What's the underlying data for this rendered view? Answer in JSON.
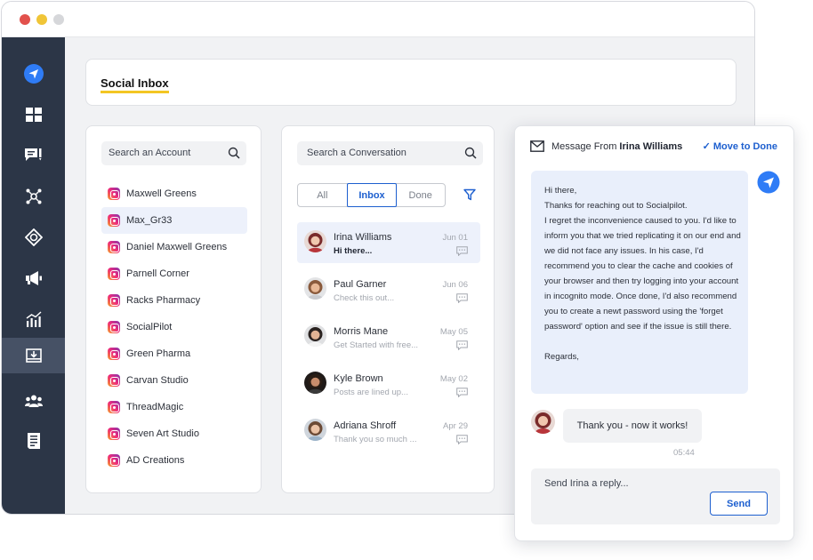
{
  "window": {
    "controls": [
      "close",
      "minimize",
      "maximize"
    ]
  },
  "sidebar": {
    "items": [
      {
        "icon": "paper-plane-icon",
        "active": false
      },
      {
        "icon": "dashboard-icon",
        "active": false
      },
      {
        "icon": "compose-icon",
        "active": false
      },
      {
        "icon": "network-icon",
        "active": false
      },
      {
        "icon": "lifebuoy-icon",
        "active": false
      },
      {
        "icon": "megaphone-icon",
        "active": false
      },
      {
        "icon": "analytics-icon",
        "active": false
      },
      {
        "icon": "inbox-icon",
        "active": true
      },
      {
        "icon": "team-icon",
        "active": false
      },
      {
        "icon": "report-icon",
        "active": false
      }
    ]
  },
  "header": {
    "title": "Social Inbox"
  },
  "accounts": {
    "search_placeholder": "Search an Account",
    "selected_index": 1,
    "items": [
      "Maxwell Greens",
      "Max_Gr33",
      "Daniel Maxwell Greens",
      "Parnell Corner",
      "Racks Pharmacy",
      "SocialPilot",
      "Green Pharma",
      "Carvan Studio",
      "ThreadMagic",
      "Seven Art Studio",
      "AD Creations"
    ]
  },
  "conversations": {
    "search_placeholder": "Search a Conversation",
    "tabs": [
      "All",
      "Inbox",
      "Done"
    ],
    "active_tab": "Inbox",
    "items": [
      {
        "name": "Irina Williams",
        "preview": "Hi there...",
        "date": "Jun 01",
        "selected": true
      },
      {
        "name": "Paul Garner",
        "preview": "Check this out...",
        "date": "Jun 06",
        "selected": false
      },
      {
        "name": "Morris Mane",
        "preview": "Get Started with free...",
        "date": "May 05",
        "selected": false
      },
      {
        "name": "Kyle Brown",
        "preview": "Posts are lined up...",
        "date": "May 02",
        "selected": false
      },
      {
        "name": "Adriana Shroff",
        "preview": "Thank you so much ...",
        "date": "Apr 29",
        "selected": false
      }
    ]
  },
  "message": {
    "from_label": "Message From",
    "from_name": "Irina Williams",
    "move_to_done": "Move to Done",
    "body": [
      "Hi there,",
      "Thanks for reaching out to Socialpilot.",
      "I regret the inconvenience caused to you. I'd like to inform you that we tried replicating it on our end and we did not face any issues. In his case, I'd recommend you to clear the cache and cookies of your browser and then try logging into your account in incognito mode. Once done, I'd also recommend you to create a newt password using the 'forget password' option and see if the issue is still there.",
      "",
      "Regards,"
    ],
    "reply": "Thank you - now it works!",
    "reply_time": "05:44",
    "composer_placeholder": "Send Irina a reply...",
    "send_label": "Send"
  },
  "colors": {
    "accent": "#1d5fcf",
    "sidebar": "#2c3647",
    "highlight": "#f3c623",
    "selected_bg": "#edf1fb"
  }
}
